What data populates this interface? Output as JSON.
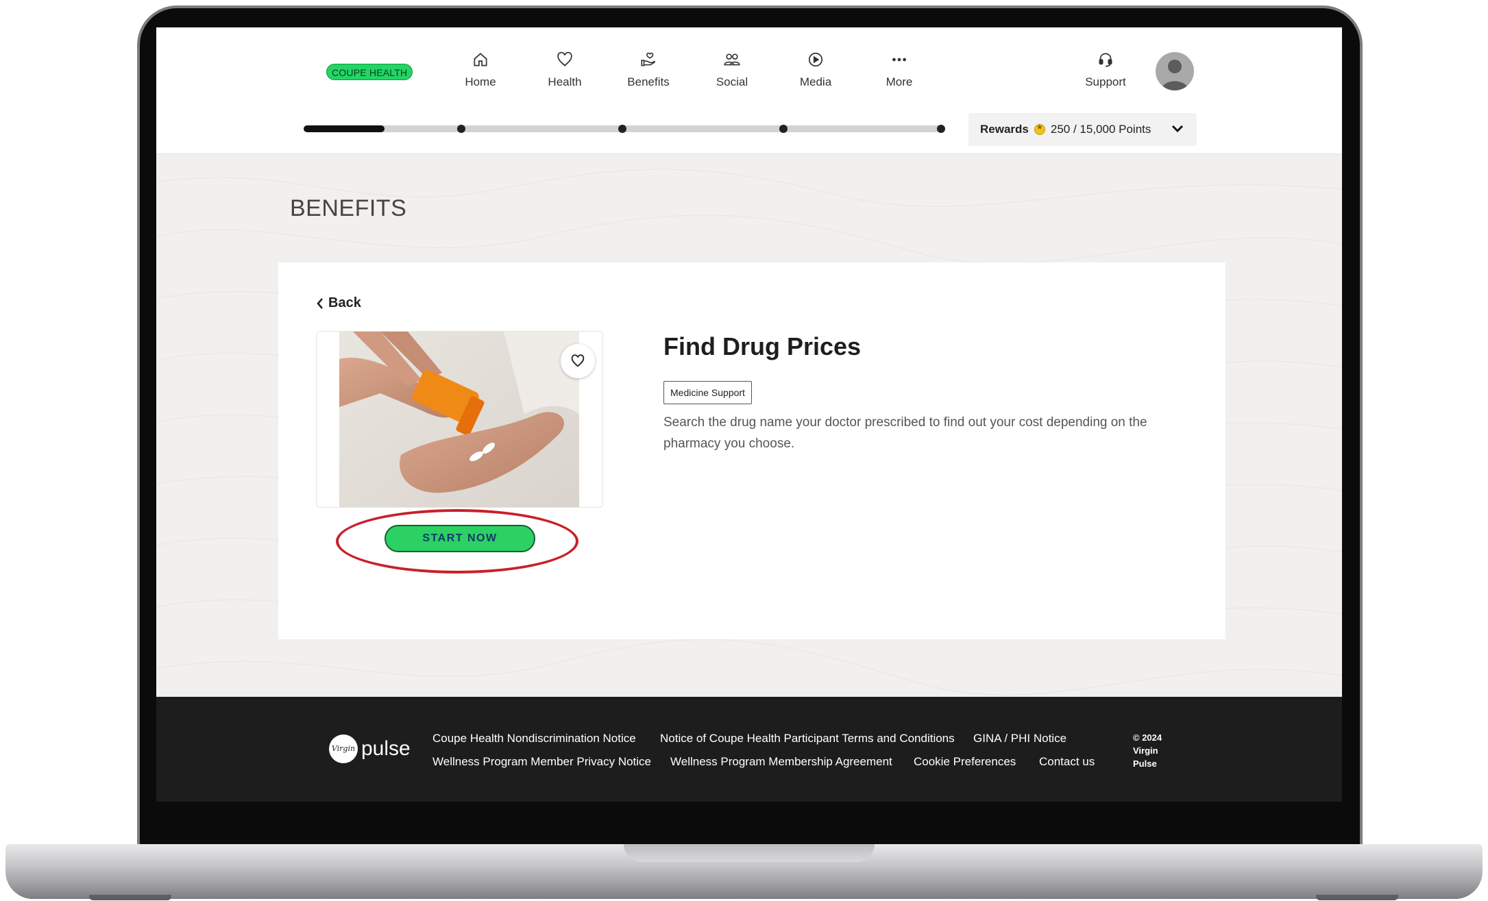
{
  "header": {
    "brand": "COUPE HEALTH",
    "nav": [
      {
        "label": "Home",
        "icon": "home-icon"
      },
      {
        "label": "Health",
        "icon": "heart-icon"
      },
      {
        "label": "Benefits",
        "icon": "hand-heart-icon"
      },
      {
        "label": "Social",
        "icon": "users-icon"
      },
      {
        "label": "Media",
        "icon": "play-circle-icon"
      },
      {
        "label": "More",
        "icon": "more-dots-icon"
      }
    ],
    "support_label": "Support"
  },
  "rewards": {
    "label": "Rewards",
    "points": "250 / 15,000 Points",
    "progress_fraction": 0.0167,
    "milestones": 4
  },
  "page": {
    "title": "BENEFITS",
    "back_label": "Back",
    "benefit": {
      "title": "Find Drug Prices",
      "tag": "Medicine Support",
      "description": "Search the drug name your doctor prescribed to find out your cost depending on the pharmacy you choose.",
      "cta": "START NOW"
    }
  },
  "footer": {
    "logo_text": "pulse",
    "logo_mark": "Virgin",
    "links_row1": [
      "Coupe Health Nondiscrimination Notice",
      "Notice of Coupe Health Participant Terms and Conditions",
      "GINA / PHI Notice"
    ],
    "links_row2": [
      "Wellness Program Member Privacy Notice",
      "Wellness Program Membership Agreement",
      "Cookie Preferences",
      "Contact us"
    ],
    "copyright": "© 2024 Virgin Pulse"
  },
  "colors": {
    "brand_green": "#23d565",
    "cta_green": "#2bd163",
    "highlight_red": "#c8202a",
    "footer_bg": "#1d1d1d"
  }
}
